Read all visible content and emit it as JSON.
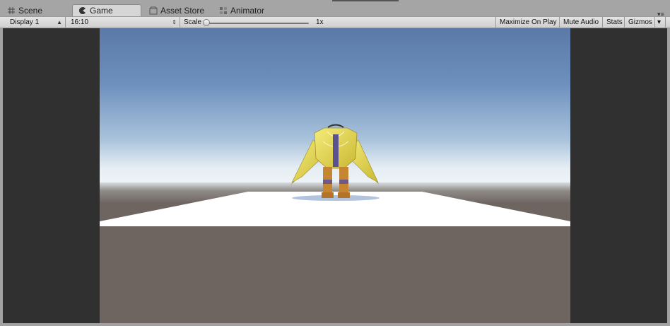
{
  "tabs": [
    {
      "label": "Scene",
      "icon": "grid-icon",
      "active": false
    },
    {
      "label": "Game",
      "icon": "pacman-icon",
      "active": true
    },
    {
      "label": "Asset Store",
      "icon": "store-icon",
      "active": false
    },
    {
      "label": "Animator",
      "icon": "animator-icon",
      "active": false
    }
  ],
  "toolbar": {
    "display": "Display 1",
    "aspect": "16:10",
    "scale_label": "Scale",
    "scale_value": "1x",
    "scale_fraction": 0.0,
    "maximize": "Maximize On Play",
    "mute": "Mute Audio",
    "stats": "Stats",
    "gizmos": "Gizmos"
  },
  "colors": {
    "sky_top": "#5a7aa8",
    "sky_horizon": "#ecf2f6",
    "ground": "#6e6560",
    "plane": "#ffffff",
    "letterbox": "#303030",
    "robot": "#e8d850"
  }
}
